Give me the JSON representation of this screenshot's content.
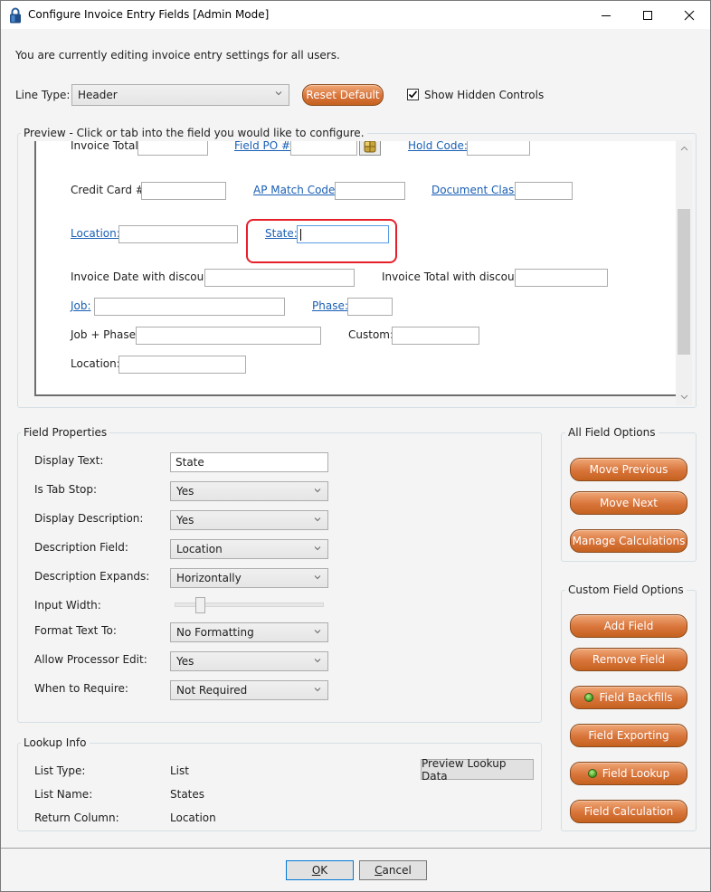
{
  "window": {
    "title": "Configure Invoice Entry Fields [Admin Mode]",
    "icon": "lock-icon",
    "controls": [
      "minimize-icon",
      "maximize-icon",
      "close-icon"
    ]
  },
  "header": {
    "notice": "You are currently editing invoice entry settings for all users.",
    "line_type_label": "Line Type:",
    "line_type_value": "Header",
    "reset_default_label": "Reset Default",
    "show_hidden_controls_label": "Show Hidden Controls",
    "show_hidden_controls_checked": true
  },
  "preview": {
    "group_title": "Preview - Click or tab into the field you would like to configure.",
    "fields": [
      {
        "label": "Invoice Total:",
        "link": false,
        "value": ""
      },
      {
        "label": "Field PO #:",
        "link": true,
        "value": "",
        "has_lookup_button": true
      },
      {
        "label": "Hold Code:",
        "link": true,
        "value": ""
      },
      {
        "label": "Credit Card #:",
        "link": false,
        "value": ""
      },
      {
        "label": "AP Match Code:",
        "link": true,
        "value": ""
      },
      {
        "label": "Document Class:",
        "link": true,
        "value": ""
      },
      {
        "label": "Location:",
        "link": true,
        "value": ""
      },
      {
        "label": "State:",
        "link": true,
        "value": "",
        "selected": true
      },
      {
        "label": "Invoice Date with discount:",
        "link": false,
        "value": ""
      },
      {
        "label": "Invoice Total with discount:",
        "link": false,
        "value": ""
      },
      {
        "label": "Job:",
        "link": true,
        "value": ""
      },
      {
        "label": "Phase:",
        "link": true,
        "value": ""
      },
      {
        "label": "Job + Phase:",
        "link": false,
        "value": ""
      },
      {
        "label": "Custom:",
        "link": false,
        "value": ""
      },
      {
        "label": "Location:",
        "link": false,
        "value": ""
      }
    ],
    "scroll_position_fraction": 0.6
  },
  "field_properties": {
    "group_title": "Field Properties",
    "display_text_label": "Display Text:",
    "display_text_value": "State",
    "is_tab_stop_label": "Is Tab Stop:",
    "is_tab_stop_value": "Yes",
    "display_description_label": "Display Description:",
    "display_description_value": "Yes",
    "description_field_label": "Description Field:",
    "description_field_value": "Location",
    "description_expands_label": "Description Expands:",
    "description_expands_value": "Horizontally",
    "input_width_label": "Input Width:",
    "input_width_fraction": 0.17,
    "format_text_label": "Format Text To:",
    "format_text_value": "No Formatting",
    "allow_processor_edit_label": "Allow Processor Edit:",
    "allow_processor_edit_value": "Yes",
    "when_to_require_label": "When to Require:",
    "when_to_require_value": "Not Required"
  },
  "lookup_info": {
    "group_title": "Lookup Info",
    "list_type_label": "List Type:",
    "list_type_value": "List",
    "list_name_label": "List Name:",
    "list_name_value": "States",
    "return_column_label": "Return Column:",
    "return_column_value": "Location",
    "preview_button_label": "Preview Lookup Data"
  },
  "all_field_options": {
    "group_title": "All Field Options",
    "buttons": [
      "Move Previous",
      "Move Next",
      "Manage Calculations"
    ]
  },
  "custom_field_options": {
    "group_title": "Custom Field Options",
    "buttons": [
      {
        "label": "Add Field",
        "indicator": false
      },
      {
        "label": "Remove Field",
        "indicator": false
      },
      {
        "label": "Field Backfills",
        "indicator": true
      },
      {
        "label": "Field Exporting",
        "indicator": false
      },
      {
        "label": "Field Lookup",
        "indicator": true
      },
      {
        "label": "Field Calculation",
        "indicator": false
      }
    ],
    "indicator_color": "#4caf27"
  },
  "footer": {
    "ok_label": "OK",
    "ok_accel": "O",
    "ok_rest": "K",
    "cancel_label": "Cancel",
    "cancel_accel": "C",
    "cancel_rest": "ancel"
  },
  "colors": {
    "accent_orange": "#d8743a",
    "link_blue": "#1a5fb4",
    "selection_red": "#e5202a"
  }
}
